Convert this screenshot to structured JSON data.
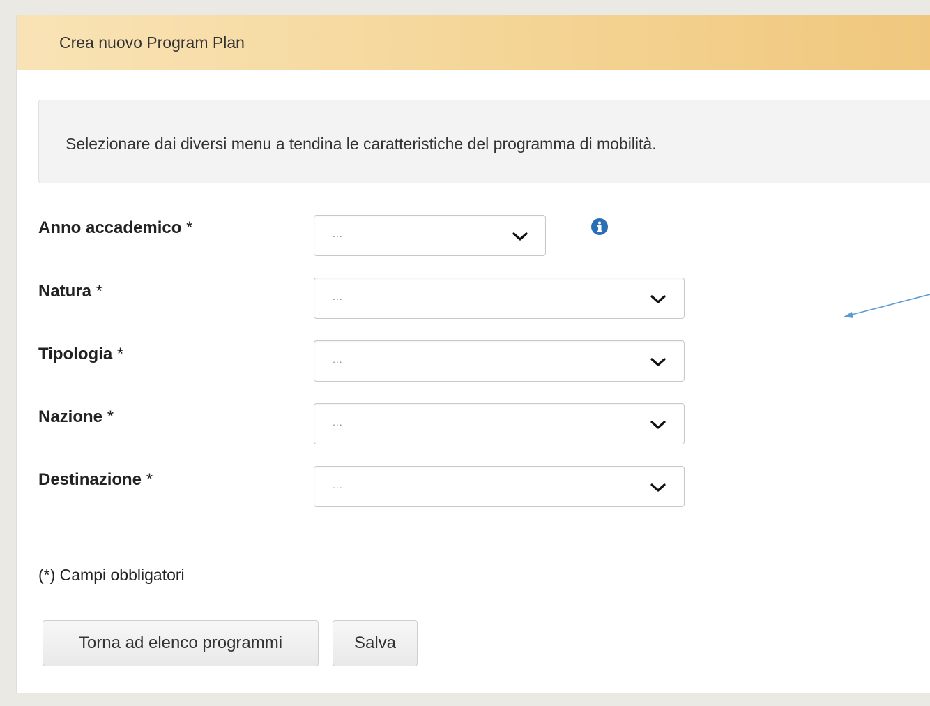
{
  "panel": {
    "title": "Crea nuovo Program Plan"
  },
  "info": {
    "text": "Selezionare dai diversi menu a tendina le caratteristiche del programma di mobilità."
  },
  "fields": [
    {
      "label": "Anno accademico",
      "required_mark": "*",
      "value": "..."
    },
    {
      "label": "Natura",
      "required_mark": "*",
      "value": "..."
    },
    {
      "label": "Tipologia",
      "required_mark": "*",
      "value": "..."
    },
    {
      "label": "Nazione",
      "required_mark": "*",
      "value": "..."
    },
    {
      "label": "Destinazione",
      "required_mark": "*",
      "value": "..."
    }
  ],
  "footer": {
    "required_note": "(*) Campi obbligatori"
  },
  "buttons": {
    "back_label": "Torna ad elenco programmi",
    "save_label": "Salva"
  },
  "icons": {
    "dropdown": "chevron-down-icon",
    "info": "info-circle-icon",
    "annotation": "arrow-annotation"
  },
  "colors": {
    "header_gradient_start": "#f9e3b6",
    "header_gradient_end": "#f0c77d",
    "info_icon": "#2a6fb5",
    "annotation_arrow": "#5b9bd5"
  }
}
